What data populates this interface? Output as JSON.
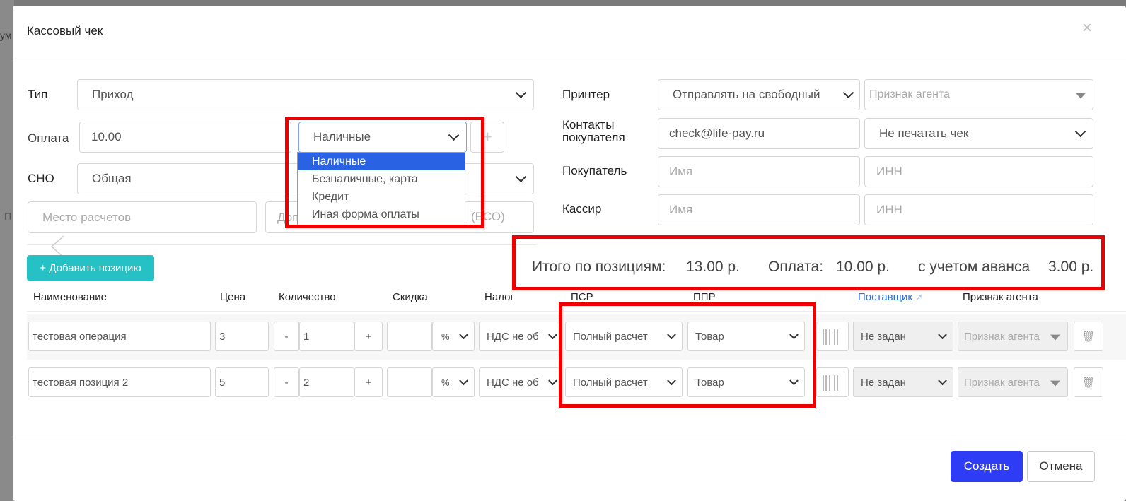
{
  "background": {
    "fragment_1": "ум",
    "fragment_2": "П"
  },
  "modal": {
    "title": "Кассовый чек",
    "close_glyph": "×",
    "form": {
      "type_label": "Тип",
      "type_value": "Приход",
      "payment_label": "Оплата",
      "payment_amount": "10.00",
      "payment_method": "Наличные",
      "add_payment_glyph": "+",
      "tax_system_label": "СНО",
      "tax_system_value": "Общая",
      "place_placeholder": "Место расчетов",
      "extra_partial_left": "Доп",
      "extra_partial_right": "(ЕСО)",
      "printer_label": "Принтер",
      "printer_value": "Отправлять на свободный",
      "agent_placeholder": "Признак агента",
      "contacts_label_1": "Контакты",
      "contacts_label_2": "покупателя",
      "contacts_value": "check@life-pay.ru",
      "print_option": "Не печатать чек",
      "buyer_label": "Покупатель",
      "buyer_name_placeholder": "Имя",
      "buyer_inn_placeholder": "ИНН",
      "cashier_label": "Кассир",
      "cashier_name_placeholder": "Имя",
      "cashier_inn_placeholder": "ИНН"
    },
    "payment_dropdown": {
      "options": [
        "Наличные",
        "Безналичные, карта",
        "Кредит",
        "Иная форма оплаты"
      ],
      "selected_index": 0
    },
    "add_position_label": "+ Добавить позицию",
    "totals": {
      "positions_label": "Итого по позициям:",
      "positions_value": "13.00 р.",
      "payment_label": "Оплата:",
      "payment_value": "10.00 р.",
      "advance_label": "с учетом аванса",
      "advance_value": "3.00 р."
    },
    "table": {
      "headers": {
        "name": "Наименование",
        "price": "Цена",
        "quantity": "Количество",
        "discount": "Скидка",
        "tax": "Налог",
        "psr": "ПСР",
        "ppr": "ППР",
        "supplier": "Поставщик",
        "agent": "Признак агента"
      },
      "rows": [
        {
          "name": "тестовая операция",
          "price": "3",
          "qty": "1",
          "discount_unit": "%",
          "tax": "НДС не об",
          "psr": "Полный расчет",
          "ppr": "Товар",
          "supplier": "Не задан",
          "agent": "Признак агента"
        },
        {
          "name": "тестовая позиция 2",
          "price": "5",
          "qty": "2",
          "discount_unit": "%",
          "tax": "НДС не об",
          "psr": "Полный расчет",
          "ppr": "Товар",
          "supplier": "Не задан",
          "agent": "Признак агента"
        }
      ],
      "minus_glyph": "-",
      "plus_glyph": "+",
      "trash_glyph": "🗑"
    },
    "buttons": {
      "create": "Создать",
      "cancel": "Отмена"
    },
    "colors": {
      "accent_teal": "#25c1c5",
      "primary_blue": "#2e3df5",
      "highlight_red": "#ee0000",
      "selected_option": "#2a62e4"
    }
  }
}
